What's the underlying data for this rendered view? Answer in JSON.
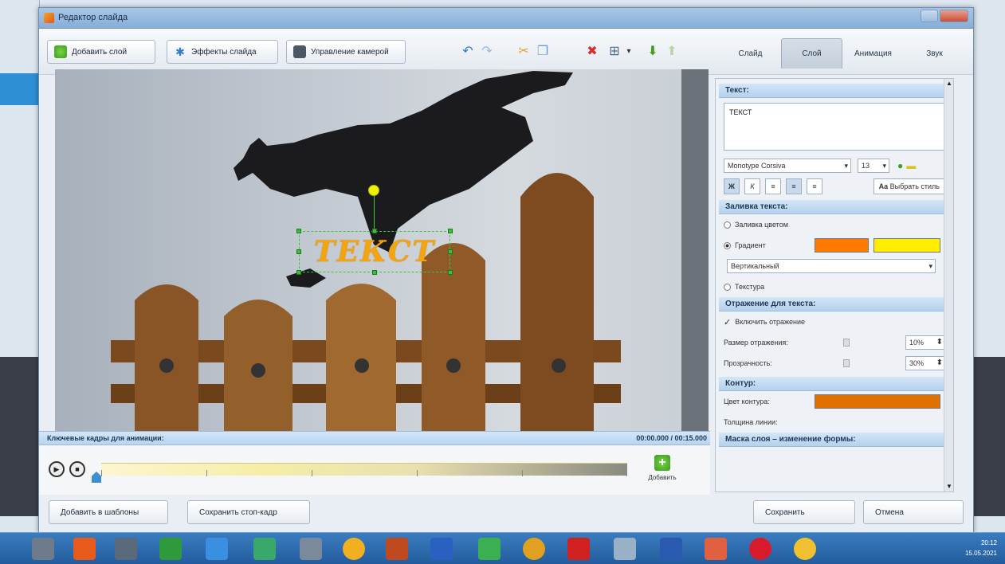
{
  "dialog": {
    "title": "Редактор слайда"
  },
  "toolbar": {
    "add_layer": "Добавить слой",
    "slide_effects": "Эффекты слайда",
    "camera_control": "Управление камерой"
  },
  "tabs": [
    {
      "label": "Слайд"
    },
    {
      "label": "Слой"
    },
    {
      "label": "Анимация"
    },
    {
      "label": "Звук"
    }
  ],
  "canvas": {
    "overlay_text": "ТЕКСТ"
  },
  "timeline": {
    "header_label": "Ключевые кадры для анимации:",
    "header_time": "00:00.000 / 00:15.000",
    "add_label": "Добавить"
  },
  "panel": {
    "text_section": "Текст:",
    "text_value": "ТЕКСТ",
    "font_name": "Monotype Corsiva",
    "font_size": "13",
    "bold": "Ж",
    "italic": "К",
    "choose_style": "Выбрать стиль",
    "fill_section": "Заливка текста:",
    "fill_solid": "Заливка цветом",
    "fill_gradient": "Градиент",
    "gradient_direction": "Вертикальный",
    "fill_texture": "Текстура",
    "reflection_section": "Отражение для текста:",
    "reflection_enable": "Включить отражение",
    "reflection_size_label": "Размер отражения:",
    "reflection_size": "10%",
    "transparency_label": "Прозрачность:",
    "transparency": "30%",
    "outline_section": "Контур:",
    "outline_color_label": "Цвет контура:",
    "outline_width_label": "Толщина линии:",
    "mask_section": "Маска слоя – изменение формы:"
  },
  "bottom": {
    "add_to_templates": "Добавить в шаблоны",
    "save_frame": "Сохранить стоп-кадр",
    "save": "Сохранить",
    "cancel": "Отмена"
  },
  "colors": {
    "gradient_start": "#ff7a00",
    "gradient_end": "#ffee00",
    "outline": "#e07000",
    "text_fill": "#f3a510"
  },
  "taskbar": {
    "time": "20:12",
    "date": "15.05.2021"
  }
}
